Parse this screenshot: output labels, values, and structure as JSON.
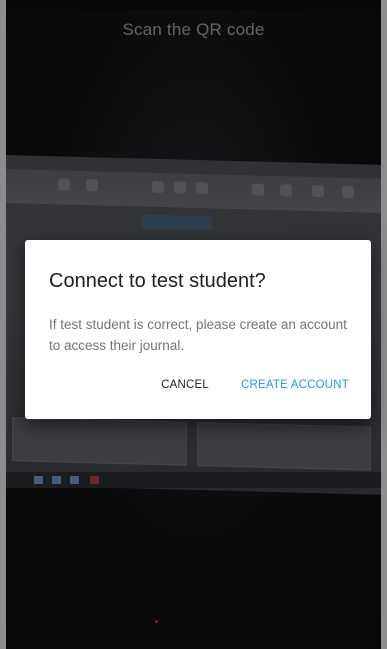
{
  "screen": {
    "title": "Scan the QR code"
  },
  "dialog": {
    "title": "Connect to test student?",
    "message": "If test student is correct, please create an account to access their journal.",
    "cancel_label": "CANCEL",
    "create_label": "CREATE ACCOUNT"
  },
  "colors": {
    "accent": "#2196f3",
    "dialog_background": "#ffffff",
    "title_text": "#9a9a9c"
  }
}
